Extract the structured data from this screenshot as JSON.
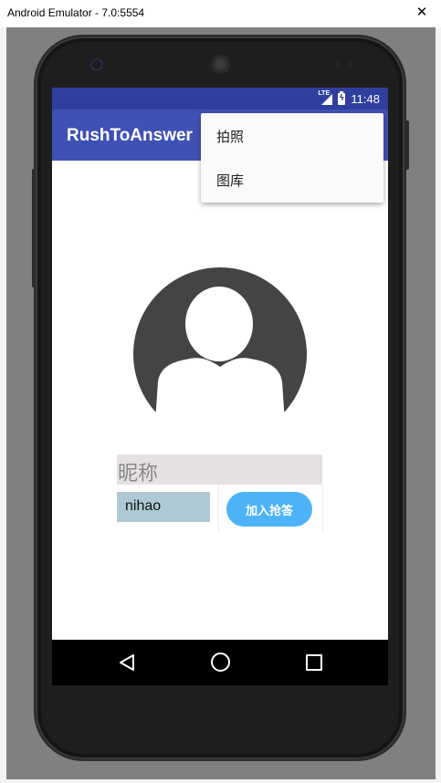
{
  "window": {
    "title": "Android Emulator - 7.0:5554",
    "close_label": "✕"
  },
  "status_bar": {
    "network": "LTE",
    "time": "11:48"
  },
  "app_bar": {
    "title": "RushToAnswer"
  },
  "overflow_menu": {
    "items": [
      {
        "label": "拍照"
      },
      {
        "label": "图库"
      }
    ]
  },
  "form": {
    "nickname_label": "昵称",
    "nickname_value": "nihao",
    "join_button": "加入抢答"
  },
  "colors": {
    "status_bar": "#303f9f",
    "app_bar": "#3f51b5",
    "button": "#4db3f8",
    "input_bg": "#aec9d3",
    "label_bg": "#e6e1e1"
  },
  "nav_bar": {
    "icons": [
      "back-icon",
      "home-icon",
      "recent-apps-icon"
    ]
  }
}
